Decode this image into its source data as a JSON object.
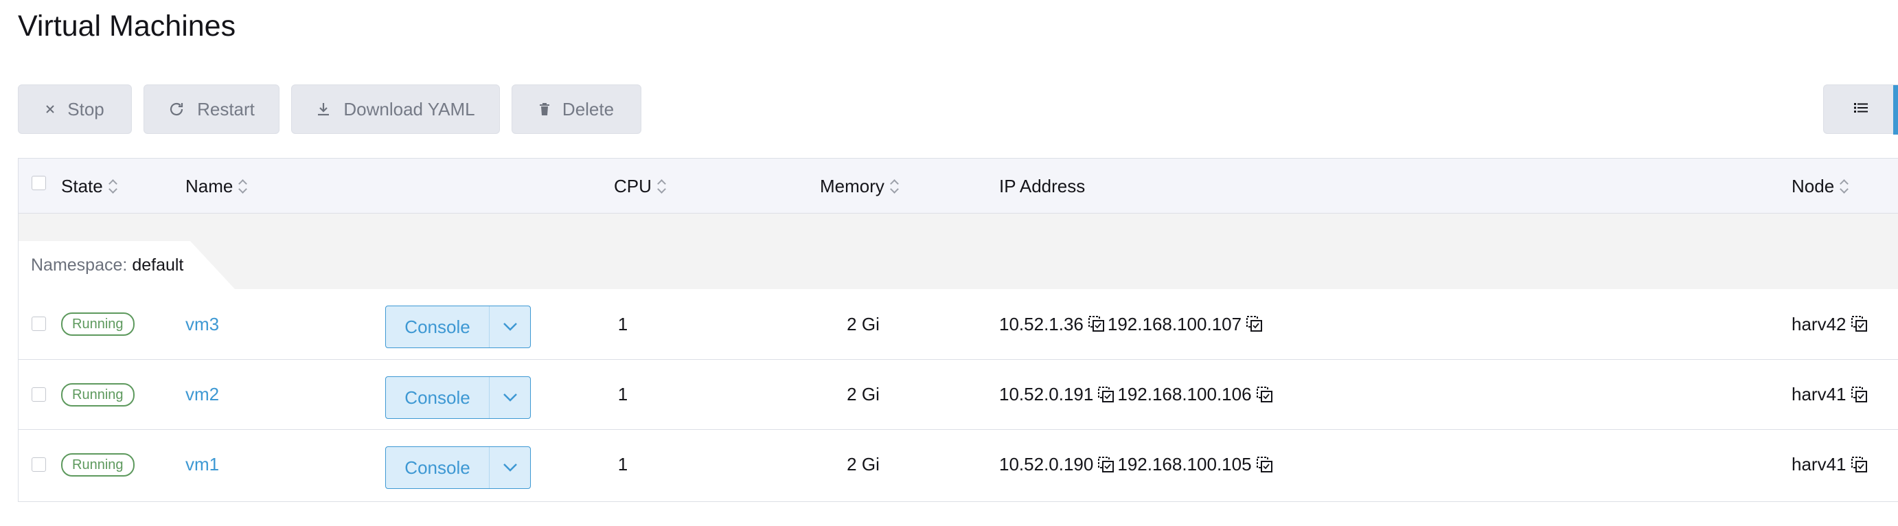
{
  "page": {
    "title": "Virtual Machines"
  },
  "toolbar": {
    "stop_label": "Stop",
    "restart_label": "Restart",
    "download_yaml_label": "Download YAML",
    "delete_label": "Delete"
  },
  "table": {
    "columns": {
      "state": "State",
      "name": "Name",
      "cpu": "CPU",
      "memory": "Memory",
      "ip_address": "IP Address",
      "node": "Node"
    },
    "group": {
      "namespace_label": "Namespace:",
      "namespace_value": "default"
    },
    "rows": [
      {
        "state": "Running",
        "name": "vm3",
        "action": "Console",
        "cpu": "1",
        "memory": "2 Gi",
        "ip1": "10.52.1.36",
        "ip2": "192.168.100.107",
        "node": "harv42"
      },
      {
        "state": "Running",
        "name": "vm2",
        "action": "Console",
        "cpu": "1",
        "memory": "2 Gi",
        "ip1": "10.52.0.191",
        "ip2": "192.168.100.106",
        "node": "harv41"
      },
      {
        "state": "Running",
        "name": "vm1",
        "action": "Console",
        "cpu": "1",
        "memory": "2 Gi",
        "ip1": "10.52.0.190",
        "ip2": "192.168.100.105",
        "node": "harv41"
      }
    ]
  },
  "colors": {
    "accent": "#3d98d3",
    "running": "#5d995d",
    "button_bg": "#e6e8ee",
    "header_bg": "#f4f5fa"
  },
  "icons": {
    "stop": "close-icon",
    "restart": "refresh-icon",
    "download": "download-icon",
    "delete": "trash-icon",
    "view": "list-icon",
    "sort": "sort-icon",
    "copy": "copy-icon",
    "dropdown": "chevron-down-icon"
  }
}
